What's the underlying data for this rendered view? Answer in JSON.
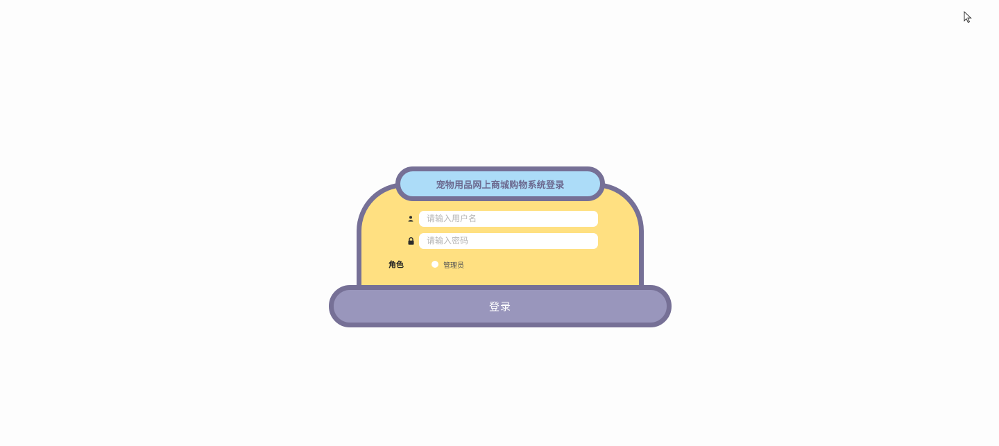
{
  "login_form": {
    "title": "宠物用品网上商城购物系统登录",
    "username": {
      "icon": "user-icon",
      "placeholder": "请输入用户名",
      "value": ""
    },
    "password": {
      "icon": "lock-icon",
      "placeholder": "请输入密码",
      "value": ""
    },
    "role": {
      "label": "角色",
      "options": [
        "管理员"
      ],
      "selected": ""
    },
    "submit_label": "登录"
  },
  "colors": {
    "background": "#fdfdfd",
    "card_fill": "#ffe081",
    "border": "#767096",
    "title_fill": "#acdcf8",
    "title_text": "#6c6a90",
    "button_fill": "#9996bc"
  }
}
